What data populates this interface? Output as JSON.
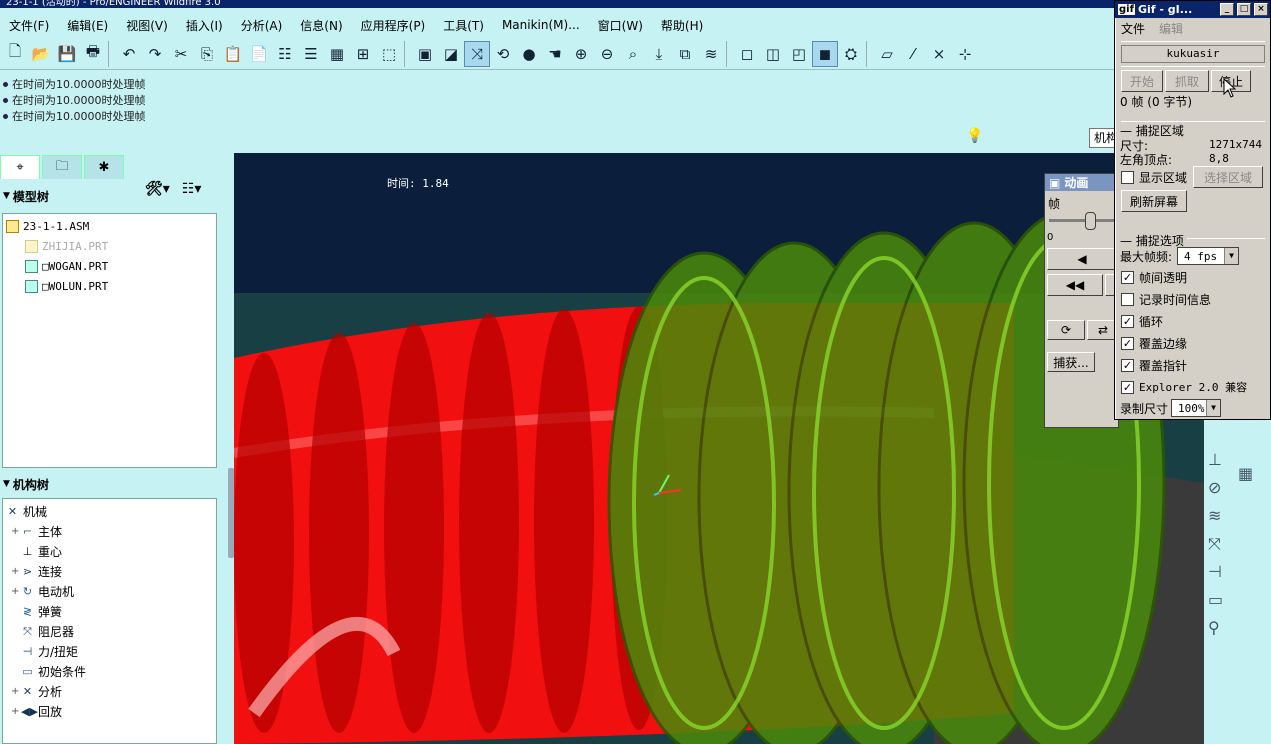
{
  "app": {
    "title": "23-1-1 (活动的) - Pro/ENGINEER Wildfire 3.0"
  },
  "menu": [
    "文件(F)",
    "编辑(E)",
    "视图(V)",
    "插入(I)",
    "分析(A)",
    "信息(N)",
    "应用程序(P)",
    "工具(T)",
    "Manikin(M)...",
    "窗口(W)",
    "帮助(H)"
  ],
  "messages": [
    "在时间为10.0000时处理帧",
    "在时间为10.0000时处理帧",
    "在时间为10.0000时处理帧"
  ],
  "status_combo": "机构",
  "model_tree": {
    "heading": "模型树",
    "items": [
      {
        "label": "23-1-1.ASM",
        "icon": "assembly-icon",
        "dim": false
      },
      {
        "label": "ZHIJIA.PRT",
        "icon": "part-icon",
        "dim": true
      },
      {
        "label": "□WOGAN.PRT",
        "icon": "part-icon",
        "dim": false
      },
      {
        "label": "□WOLUN.PRT",
        "icon": "part-icon",
        "dim": false
      }
    ]
  },
  "mech_tree": {
    "heading": "机构树",
    "items": [
      {
        "label": "机械",
        "icon": "mechanism-icon",
        "expander": ""
      },
      {
        "label": "主体",
        "icon": "body-icon",
        "expander": "+"
      },
      {
        "label": "重心",
        "icon": "gravity-icon",
        "expander": ""
      },
      {
        "label": "连接",
        "icon": "connection-icon",
        "expander": "+"
      },
      {
        "label": "电动机",
        "icon": "motor-icon",
        "expander": "+"
      },
      {
        "label": "弹簧",
        "icon": "spring-icon",
        "expander": ""
      },
      {
        "label": "阻尼器",
        "icon": "damper-icon",
        "expander": ""
      },
      {
        "label": "力/扭矩",
        "icon": "force-icon",
        "expander": ""
      },
      {
        "label": "初始条件",
        "icon": "initial-condition-icon",
        "expander": ""
      },
      {
        "label": "分析",
        "icon": "analysis-icon",
        "expander": "+"
      },
      {
        "label": "回放",
        "icon": "playback-icon",
        "expander": "+"
      }
    ]
  },
  "viewport": {
    "time_label": "时间: 1.84"
  },
  "gif_window": {
    "title": "Gif - gI...",
    "menu_file": "文件",
    "menu_edit": "编辑",
    "name": "kukuasir",
    "btn_start": "开始",
    "btn_grab": "抓取",
    "btn_stop": "停止",
    "frames_info": "0 帧 (0 字节)",
    "capture_area_heading": "捕捉区域",
    "size_label": "尺寸:",
    "size_value": "1271x744",
    "origin_label": "左角顶点:",
    "origin_value": "8,8",
    "show_area_label": "显示区域",
    "select_area_btn": "选择区域",
    "refresh_btn": "刷新屏幕",
    "capture_options_heading": "捕捉选项",
    "max_fps_label": "最大帧频:",
    "max_fps_value": "4 fps",
    "options": [
      {
        "label": "帧间透明",
        "checked": true
      },
      {
        "label": "记录时间信息",
        "checked": false
      },
      {
        "label": "循环",
        "checked": true
      },
      {
        "label": "覆盖边缘",
        "checked": true
      },
      {
        "label": "覆盖指针",
        "checked": true
      },
      {
        "label": "Explorer 2.0 兼容",
        "checked": true
      }
    ],
    "record_size_label": "录制尺寸",
    "record_size_value": "100%"
  },
  "anim_window": {
    "title": "动画",
    "frame_label": "帧",
    "slider_min": "0",
    "capture_btn": "捕获..."
  },
  "colors": {
    "ui_bg": "#c6f2f4",
    "viewport_bg": "#0b1f3c",
    "worm": "#ff1a1a",
    "gear": "#4f8a0c"
  }
}
